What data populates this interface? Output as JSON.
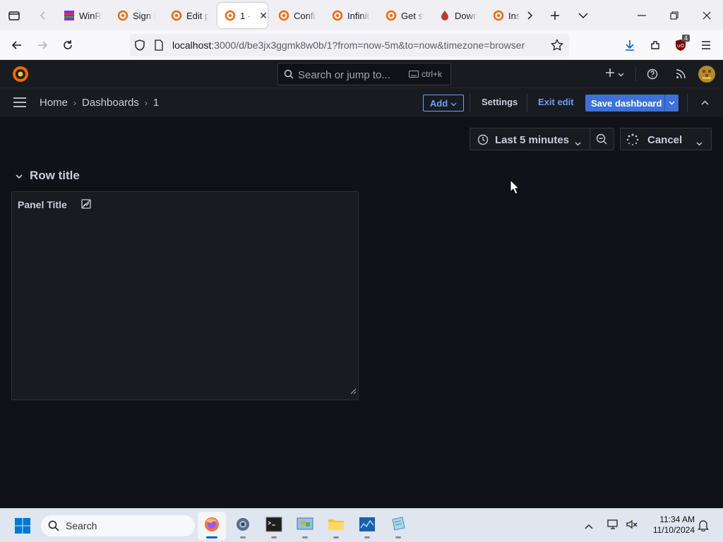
{
  "browser": {
    "tabs": [
      {
        "label": "WinR",
        "icon": "winrar-icon"
      },
      {
        "label": "Sign i",
        "icon": "grafana-icon"
      },
      {
        "label": "Edit p",
        "icon": "grafana-icon"
      },
      {
        "label": "1 -",
        "icon": "grafana-icon",
        "active": true
      },
      {
        "label": "Confi",
        "icon": "grafana-icon"
      },
      {
        "label": "Infinit",
        "icon": "grafana-icon"
      },
      {
        "label": "Get st",
        "icon": "grafana-icon"
      },
      {
        "label": "Down",
        "icon": "download-flame-icon"
      },
      {
        "label": "Ins",
        "icon": "grafana-icon"
      }
    ],
    "url_host": "localhost",
    "url_rest": ":3000/d/be3jx3ggmk8w0b/1?from=now-5m&to=now&timezone=browser",
    "extension_badge": "4"
  },
  "grafana": {
    "search_placeholder": "Search or jump to...",
    "search_shortcut": "ctrl+k",
    "breadcrumbs": [
      "Home",
      "Dashboards",
      "1"
    ],
    "add_label": "Add",
    "settings_label": "Settings",
    "exit_edit_label": "Exit edit",
    "save_label": "Save dashboard",
    "time_range": "Last 5 minutes",
    "cancel_label": "Cancel",
    "row_title": "Row title",
    "panel_title": "Panel Title",
    "accent_color": "#3d71d9",
    "link_color": "#6e9fff"
  },
  "taskbar": {
    "search_placeholder": "Search",
    "time": "11:34 AM",
    "date": "11/10/2024"
  }
}
